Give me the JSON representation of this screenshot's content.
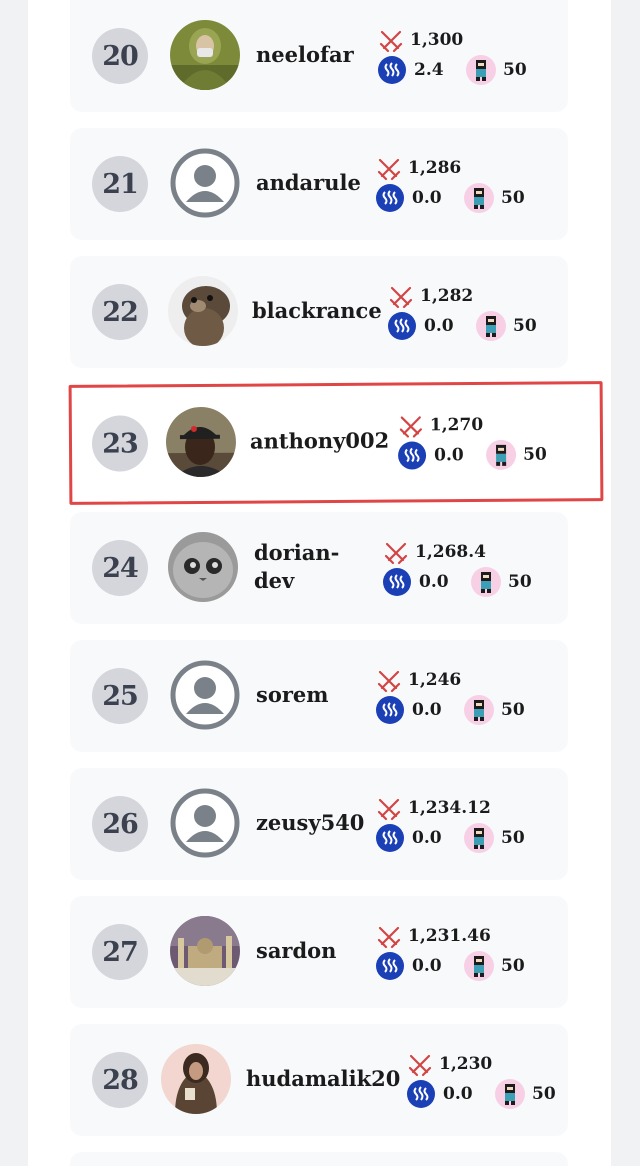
{
  "leaderboard": {
    "rows": [
      {
        "rank": "20",
        "username": "neelofar",
        "power": "1,300",
        "balance": "2.4",
        "level": "50",
        "avatar": "portrait-green-veil"
      },
      {
        "rank": "21",
        "username": "andarule",
        "power": "1,286",
        "balance": "0.0",
        "level": "50",
        "avatar": "default-user-icon"
      },
      {
        "rank": "22",
        "username": "blackrance",
        "power": "1,282",
        "balance": "0.0",
        "level": "50",
        "avatar": "otter-photo"
      },
      {
        "rank": "23",
        "username": "anthony002",
        "power": "1,270",
        "balance": "0.0",
        "level": "50",
        "avatar": "portrait-red-cap",
        "highlighted": true
      },
      {
        "rank": "24",
        "username_line1": "dorian-",
        "username_line2": "dev",
        "power": "1,268.4",
        "balance": "0.0",
        "level": "50",
        "avatar": "grey-cat-photo"
      },
      {
        "rank": "25",
        "username": "sorem",
        "power": "1,246",
        "balance": "0.0",
        "level": "50",
        "avatar": "default-user-icon"
      },
      {
        "rank": "26",
        "username": "zeusy540",
        "power": "1,234.12",
        "balance": "0.0",
        "level": "50",
        "avatar": "default-user-icon"
      },
      {
        "rank": "27",
        "username": "sardon",
        "power": "1,231.46",
        "balance": "0.0",
        "level": "50",
        "avatar": "mosque-night-photo"
      },
      {
        "rank": "28",
        "username": "hudamalik20",
        "power": "1,230",
        "balance": "0.0",
        "level": "50",
        "avatar": "hooded-figure-illustration"
      }
    ]
  },
  "colors": {
    "highlight_border": "#e04646",
    "rank_badge": "#d4d6dc",
    "steem_icon": "#1b3fb5",
    "card_bg": "#f8f9fb"
  },
  "icons": {
    "power": "crossed-swords-icon",
    "balance": "steem-coin-icon",
    "level": "ninja-badge-icon"
  }
}
